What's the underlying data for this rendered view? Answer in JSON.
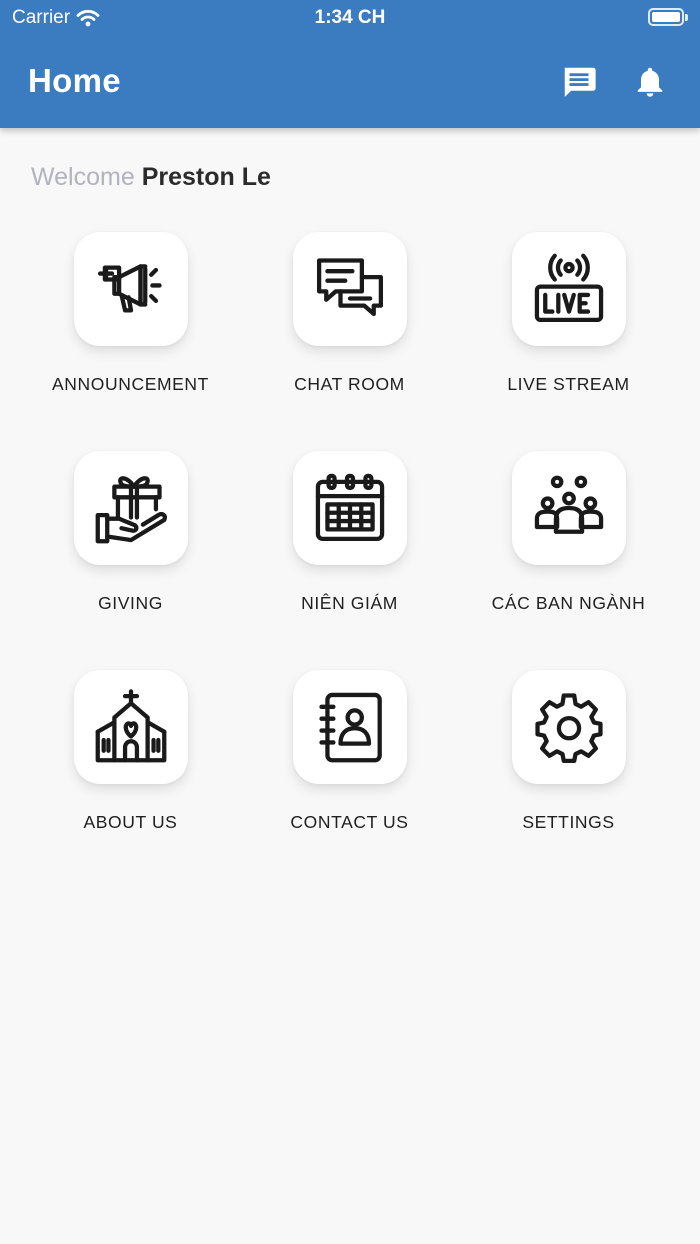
{
  "status_bar": {
    "carrier": "Carrier",
    "time": "1:34 CH",
    "battery_level": 1.0
  },
  "header": {
    "title": "Home",
    "background_color": "#3b7bbf",
    "actions": [
      {
        "icon": "message-icon"
      },
      {
        "icon": "bell-icon"
      }
    ]
  },
  "welcome": {
    "prefix": "Welcome",
    "user_name": "Preston Le"
  },
  "menu": [
    {
      "label": "ANNOUNCEMENT",
      "icon": "megaphone-icon"
    },
    {
      "label": "CHAT ROOM",
      "icon": "chat-bubbles-icon"
    },
    {
      "label": "LIVE STREAM",
      "icon": "live-broadcast-icon"
    },
    {
      "label": "GIVING",
      "icon": "gift-hand-icon"
    },
    {
      "label": "NIÊN GIÁM",
      "icon": "calendar-icon"
    },
    {
      "label": "CÁC BAN NGÀNH",
      "icon": "group-icon"
    },
    {
      "label": "ABOUT US",
      "icon": "church-icon"
    },
    {
      "label": "CONTACT US",
      "icon": "contact-book-icon"
    },
    {
      "label": "SETTINGS",
      "icon": "gear-icon"
    }
  ]
}
